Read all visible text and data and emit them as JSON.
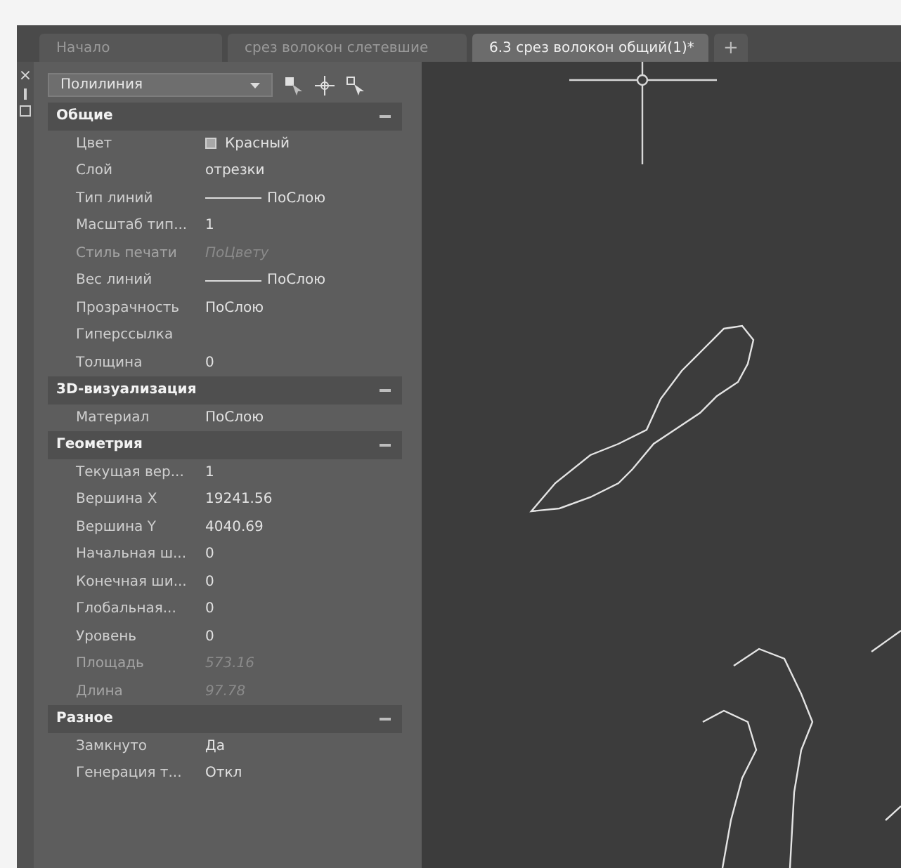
{
  "tabs": [
    {
      "label": "Начало",
      "selected": false
    },
    {
      "label": "срез волокон слетевшие",
      "selected": false
    },
    {
      "label": "6.3 срез волокон общий(1)*",
      "selected": true
    }
  ],
  "new_tab": "+",
  "side_strip": {
    "close": "×"
  },
  "properties": {
    "object_type": "Полилиния",
    "sections": [
      {
        "title": "Общие",
        "expanded": true,
        "rows": [
          {
            "label": "Цвет",
            "value": "Красный",
            "kind": "color",
            "disabled": false
          },
          {
            "label": "Слой",
            "value": "отрезки",
            "kind": "text",
            "disabled": false
          },
          {
            "label": "Тип линий",
            "value": "ПоСлою",
            "kind": "line",
            "disabled": false
          },
          {
            "label": "Масштаб тип...",
            "value": "1",
            "kind": "text",
            "disabled": false
          },
          {
            "label": "Стиль печати",
            "value": "ПоЦвету",
            "kind": "text",
            "disabled": true
          },
          {
            "label": "Вес линий",
            "value": "ПоСлою",
            "kind": "line",
            "disabled": false
          },
          {
            "label": "Прозрачность",
            "value": "ПоСлою",
            "kind": "text",
            "disabled": false
          },
          {
            "label": "Гиперссылка",
            "disabled": false
          },
          {
            "label": "Толщина",
            "value": "0",
            "kind": "text",
            "disabled": false
          }
        ]
      },
      {
        "title": "3D-визуализация",
        "expanded": true,
        "rows": [
          {
            "label": "Материал",
            "value": "ПоСлою",
            "kind": "text",
            "disabled": false
          }
        ]
      },
      {
        "title": "Геометрия",
        "expanded": true,
        "rows": [
          {
            "label": "Текущая вер...",
            "value": "1",
            "kind": "text",
            "disabled": false
          },
          {
            "label": "Вершина X",
            "value": "19241.56",
            "kind": "text",
            "disabled": false
          },
          {
            "label": "Вершина Y",
            "value": "4040.69",
            "kind": "text",
            "disabled": false
          },
          {
            "label": "Начальная ш...",
            "value": "0",
            "kind": "text",
            "disabled": false
          },
          {
            "label": "Конечная ши...",
            "value": "0",
            "kind": "text",
            "disabled": false
          },
          {
            "label": "Глобальная...",
            "value": "0",
            "kind": "text",
            "disabled": false
          },
          {
            "label": "Уровень",
            "value": "0",
            "kind": "text",
            "disabled": false
          },
          {
            "label": "Площадь",
            "value": "573.16",
            "kind": "text",
            "disabled": true
          },
          {
            "label": "Длина",
            "value": "97.78",
            "kind": "text",
            "disabled": true
          }
        ]
      },
      {
        "title": "Разное",
        "expanded": true,
        "rows": [
          {
            "label": "Замкнуто",
            "value": "Да",
            "kind": "text",
            "disabled": false
          },
          {
            "label": "Генерация т...",
            "value": "Откл",
            "kind": "text",
            "disabled": false
          }
        ]
      }
    ]
  }
}
